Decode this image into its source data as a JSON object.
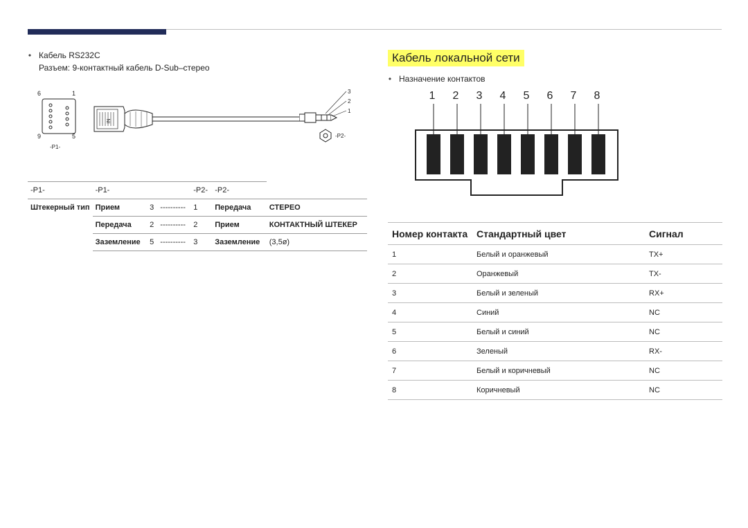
{
  "left": {
    "bullet": "Кабель RS232C",
    "subline": "Разъем: 9-контактный кабель D-Sub–стерео",
    "diagram": {
      "pins": {
        "p6": "6",
        "p1": "1",
        "p9": "9",
        "p5": "5"
      },
      "p1label": "-P1-",
      "in": "IN",
      "jack_nums": {
        "n1": "3",
        "n2": "2",
        "n3": "1"
      },
      "p2label": "-P2-"
    },
    "table": {
      "head": {
        "c1": "-P1-",
        "c2": "-P1-",
        "c3": "",
        "c4": "",
        "c5": "-P2-",
        "c6": "-P2-"
      },
      "rowspan_label": "Штекерный тип",
      "rows": [
        {
          "a": "Прием",
          "b": "3",
          "c": "----------",
          "d": "1",
          "e": "Передача",
          "f": "СТЕРЕО"
        },
        {
          "a": "Передача",
          "b": "2",
          "c": "----------",
          "d": "2",
          "e": "Прием",
          "f": "КОНТАКТНЫЙ ШТЕКЕР"
        },
        {
          "a": "Заземление",
          "b": "5",
          "c": "----------",
          "d": "3",
          "e": "Заземление",
          "f": "(3,5ø)"
        }
      ]
    }
  },
  "right": {
    "title": "Кабель локальной сети",
    "bullet": "Назначение контактов",
    "pin_nums": [
      "1",
      "2",
      "3",
      "4",
      "5",
      "6",
      "7",
      "8"
    ],
    "lan_head": {
      "c1": "Номер контакта",
      "c2": "Стандартный цвет",
      "c3": "Сигнал"
    },
    "lan_rows": [
      {
        "n": "1",
        "c": "Белый и оранжевый",
        "s": "TX+"
      },
      {
        "n": "2",
        "c": "Оранжевый",
        "s": "TX-"
      },
      {
        "n": "3",
        "c": "Белый и зеленый",
        "s": "RX+"
      },
      {
        "n": "4",
        "c": "Синий",
        "s": "NC"
      },
      {
        "n": "5",
        "c": "Белый и синий",
        "s": "NC"
      },
      {
        "n": "6",
        "c": "Зеленый",
        "s": "RX-"
      },
      {
        "n": "7",
        "c": "Белый и коричневый",
        "s": "NC"
      },
      {
        "n": "8",
        "c": "Коричневый",
        "s": "NC"
      }
    ]
  }
}
